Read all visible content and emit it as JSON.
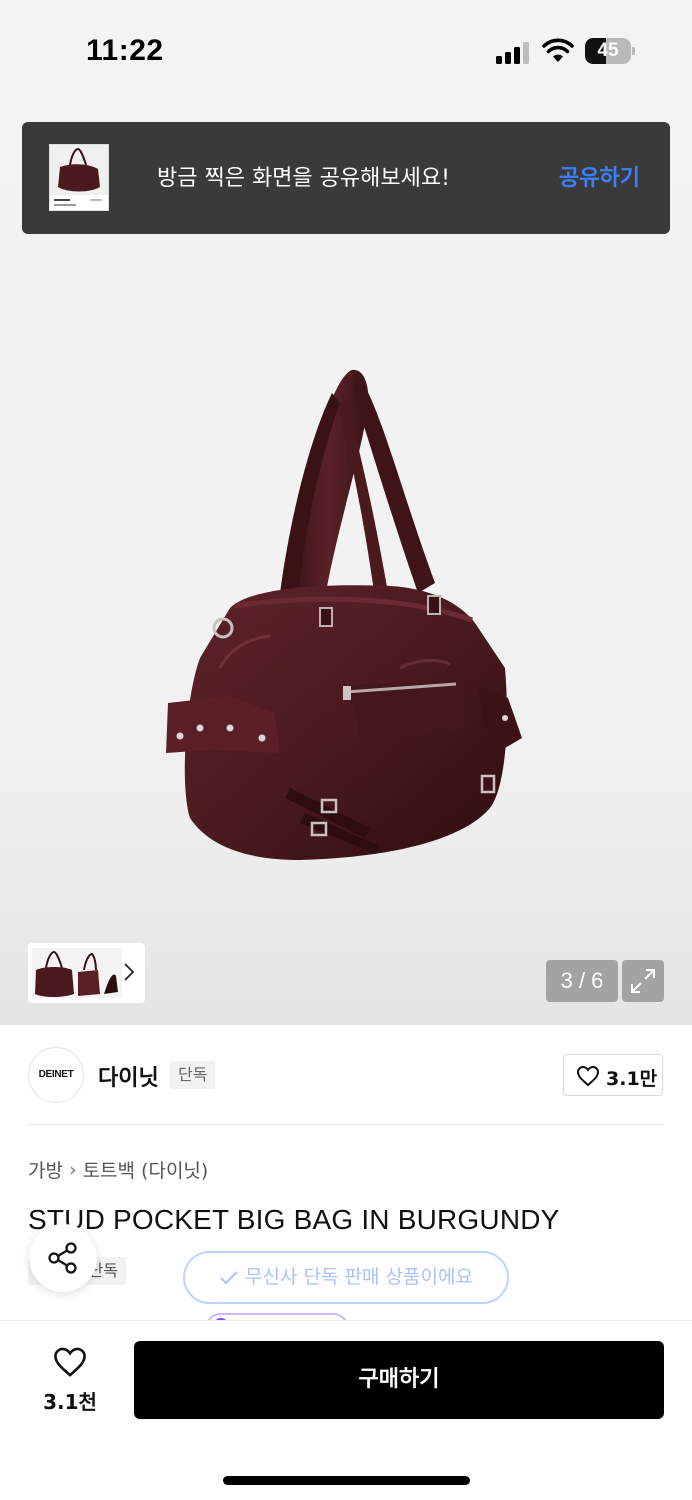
{
  "status_bar": {
    "time": "11:22",
    "battery_percent": 45,
    "battery_label": "45",
    "icons": [
      "signal-icon",
      "wifi-icon",
      "battery-icon"
    ]
  },
  "share_toast": {
    "message": "방금 찍은 화면을 공유해보세요!",
    "action_label": "공유하기",
    "action_color": "#3d80ff"
  },
  "gallery": {
    "counter": "3 / 6",
    "current": 3,
    "total": 6,
    "expand_icon": "expand-icon",
    "thumb_next_icon": "chevron-right-icon"
  },
  "brand": {
    "logo_text": "DEINET",
    "name": "다이닛",
    "badge": "단독",
    "like_count": "3.1만"
  },
  "product": {
    "breadcrumb": [
      "가방",
      "토트백 (다이닛)"
    ],
    "title": "STUD POCKET BIG BAG IN BURGUNDY",
    "exclusive_tag": "단독",
    "exclusive_notice": "무신사 단독 판매 상품이에요"
  },
  "bottom_bar": {
    "like_count": "3.1천",
    "buy_label": "구매하기"
  },
  "colors": {
    "bag": "#4a1a1e",
    "buy_button": "#000000",
    "link_blue": "#3d80ff"
  }
}
